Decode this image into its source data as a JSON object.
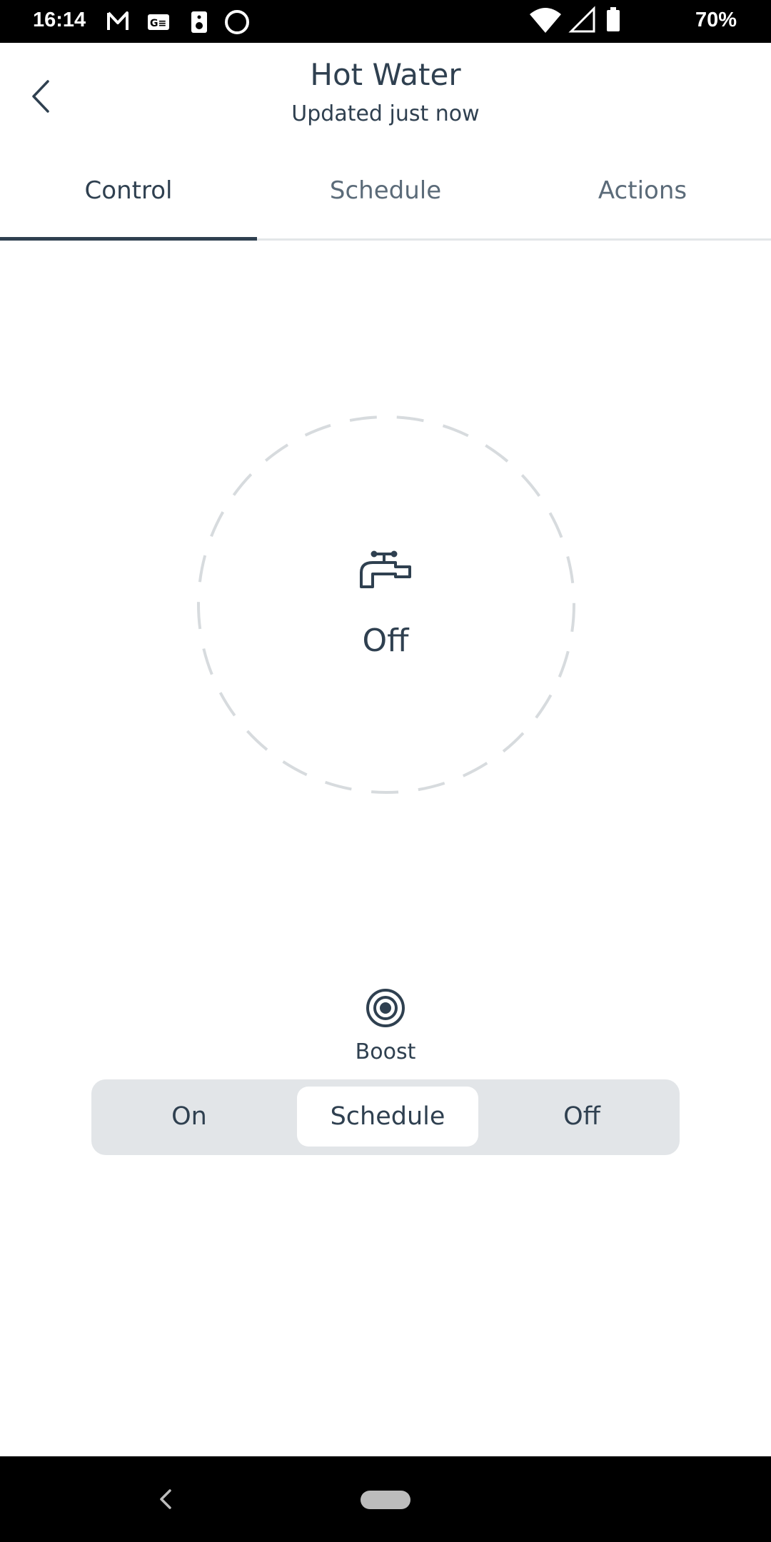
{
  "status_bar": {
    "time": "16:14",
    "battery": "70%",
    "left_icons": [
      "gmail-icon",
      "news-icon",
      "speaker-icon",
      "circle-icon"
    ],
    "right_icons": [
      "wifi-icon",
      "signal-icon",
      "battery-icon"
    ]
  },
  "header": {
    "title": "Hot Water",
    "subtitle": "Updated just now"
  },
  "tabs": [
    {
      "label": "Control",
      "active": true
    },
    {
      "label": "Schedule",
      "active": false
    },
    {
      "label": "Actions",
      "active": false
    }
  ],
  "status": {
    "icon": "tap-icon",
    "state": "Off"
  },
  "boost": {
    "label": "Boost",
    "icon": "target-icon"
  },
  "mode": {
    "options": [
      "On",
      "Schedule",
      "Off"
    ],
    "selected": "Schedule"
  },
  "colors": {
    "text": "#2f4050",
    "segment_bg": "#e2e5e8",
    "dial_dash": "#d7dbde"
  }
}
